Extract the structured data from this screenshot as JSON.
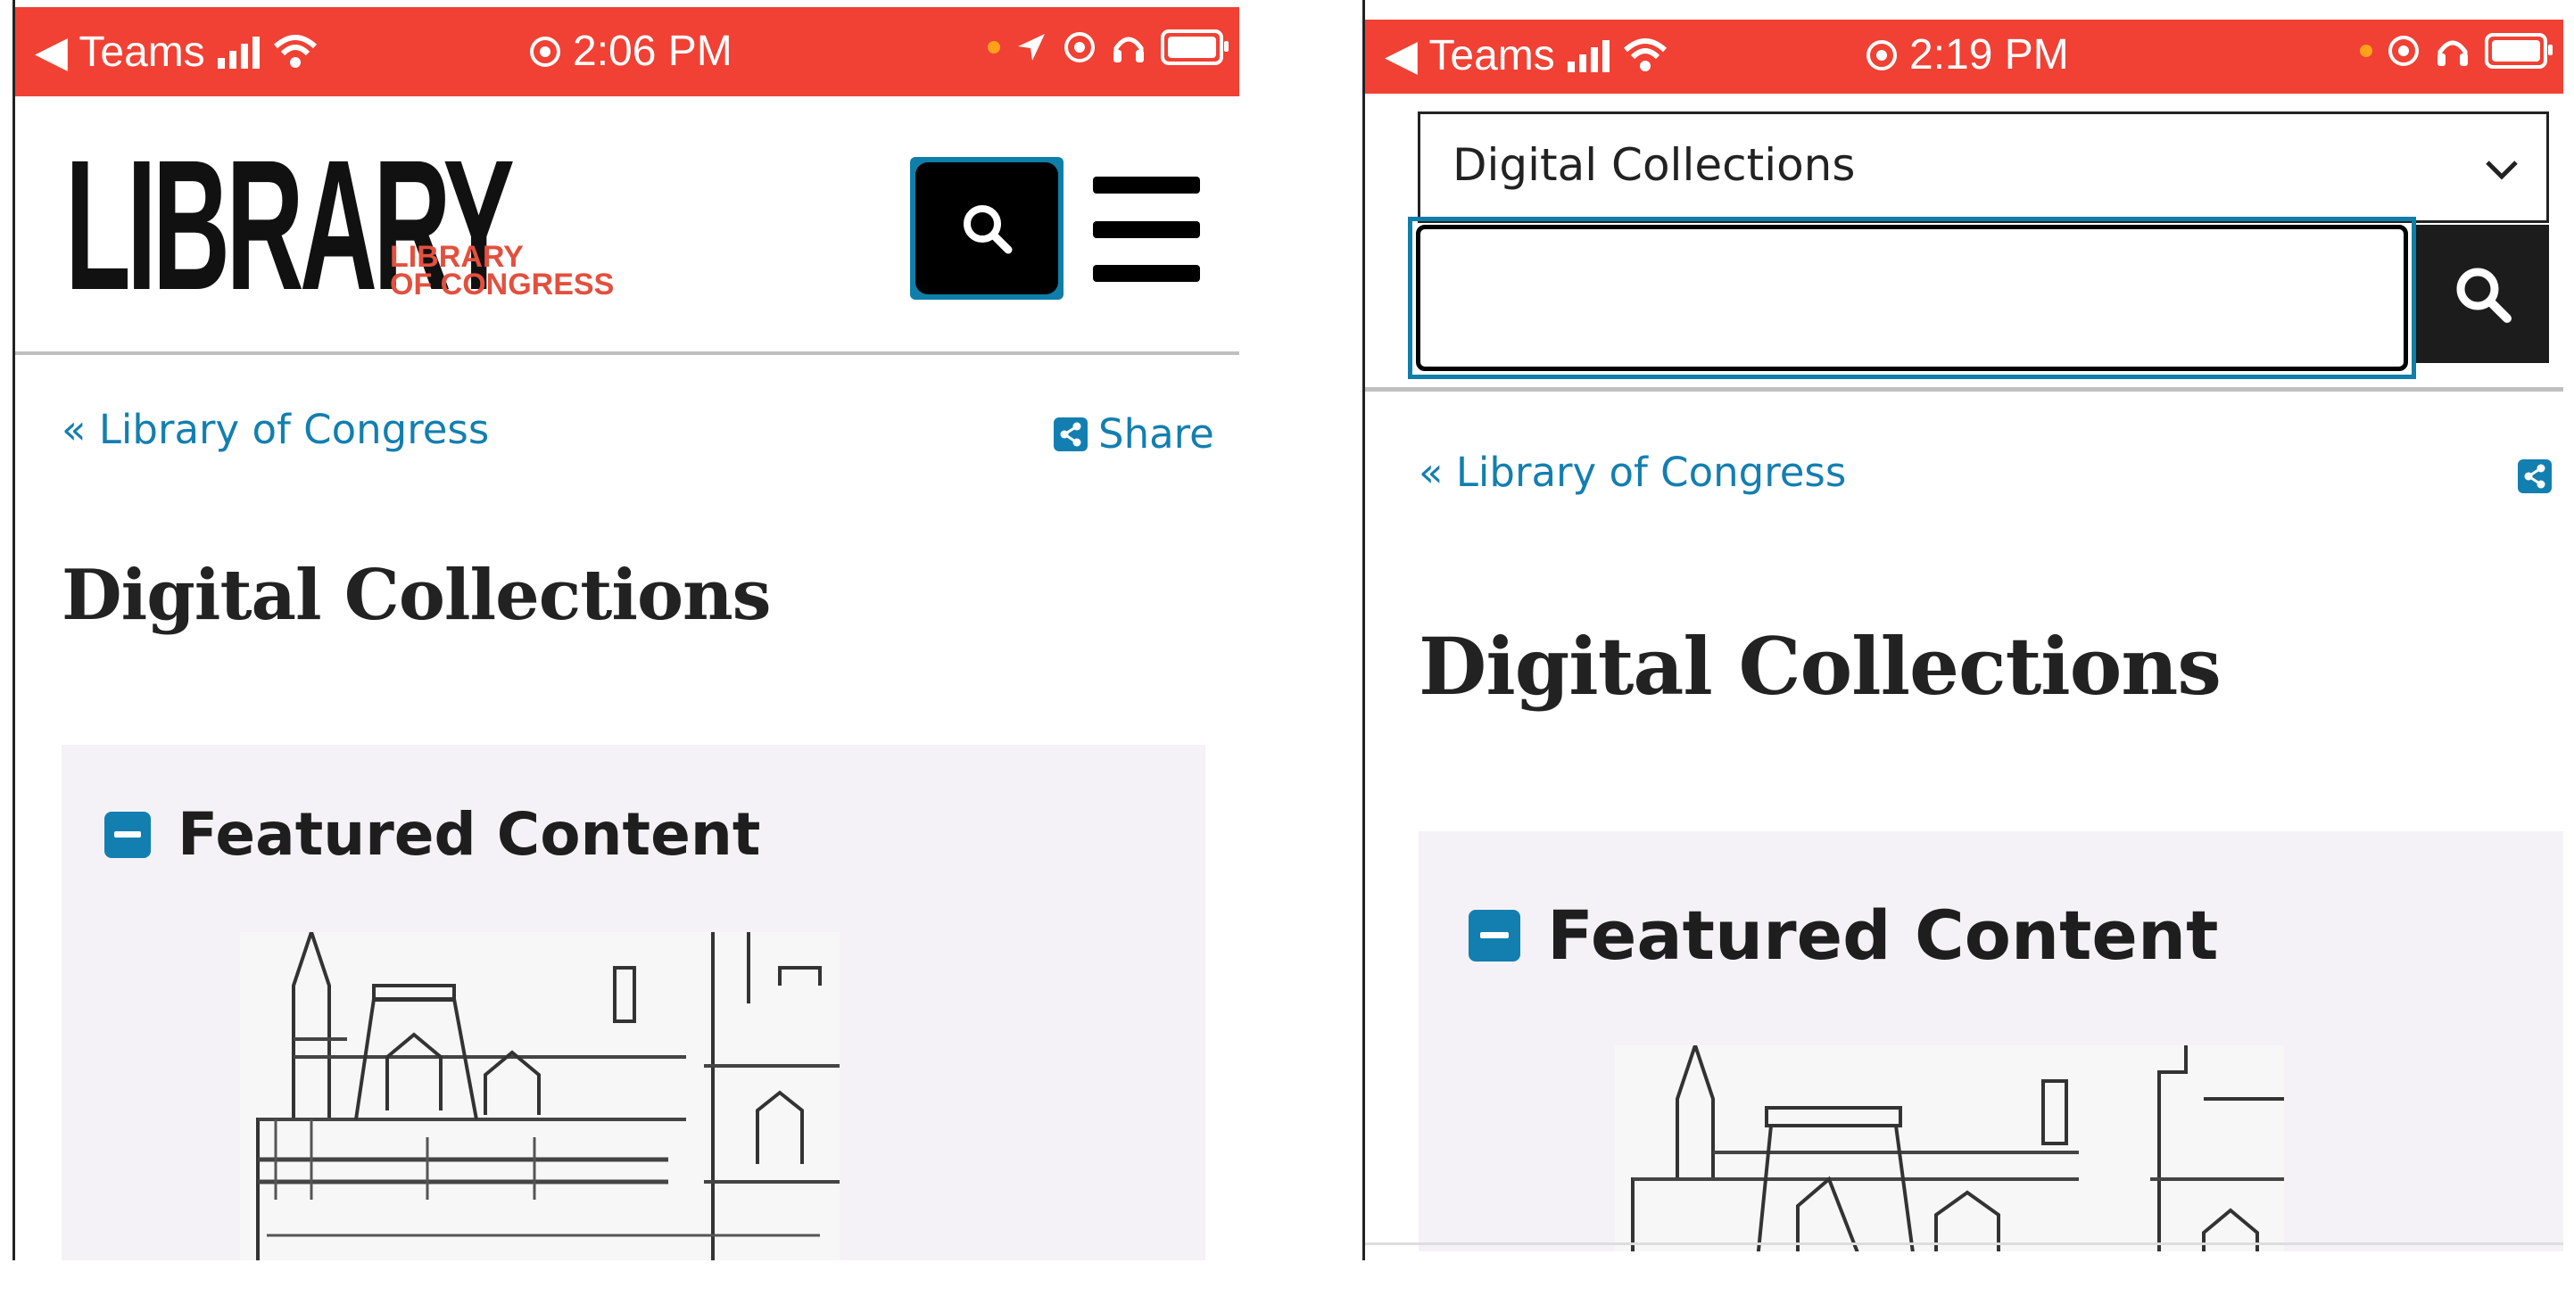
{
  "screens": [
    {
      "status_bar": {
        "back_app": "◀ Teams",
        "time": "2:06 PM"
      },
      "header": {
        "logo_main": "LIBRARY",
        "logo_sub_line1": "LIBRARY",
        "logo_sub_line2": "OF CONGRESS"
      },
      "breadcrumb": "« Library of Congress",
      "share_label": "Share",
      "page_title": "Digital Collections",
      "featured_title": "Featured Content"
    },
    {
      "status_bar": {
        "back_app": "◀ Teams",
        "time": "2:19 PM"
      },
      "search": {
        "collection_selected": "Digital Collections",
        "query_value": ""
      },
      "breadcrumb": "« Library of Congress",
      "page_title": "Digital Collections",
      "featured_title": "Featured Content"
    }
  ],
  "colors": {
    "status_bar_bg": "#f04134",
    "logo_accent": "#e3503e",
    "link_blue": "#137fb0",
    "focus_ring": "#0f7ea8",
    "featured_bg": "#f4f2f6"
  },
  "icons": [
    "signal-icon",
    "wifi-icon",
    "location-icon",
    "orientation-lock-icon",
    "headphones-icon",
    "battery-icon",
    "search-icon",
    "menu-icon",
    "share-icon",
    "collapse-minus-icon",
    "chevron-down-icon"
  ]
}
